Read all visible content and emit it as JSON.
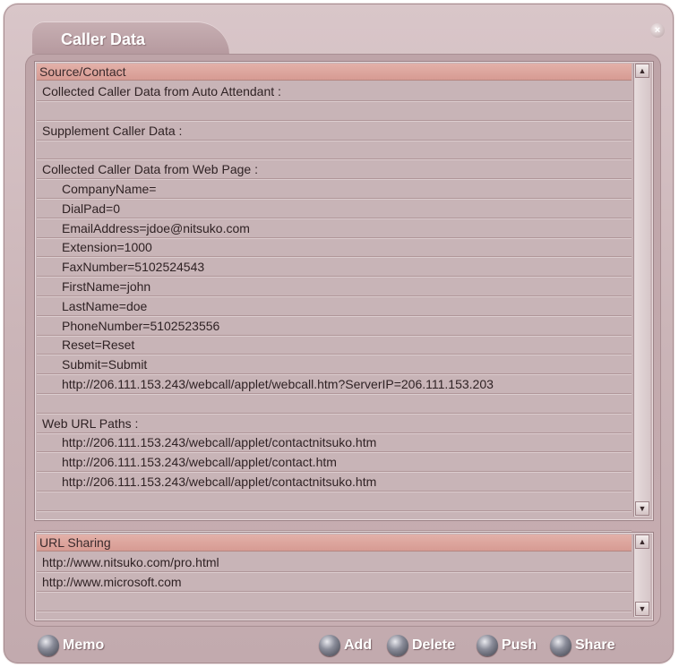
{
  "window": {
    "title": "Caller Data",
    "close_icon": "close-icon"
  },
  "source_list": {
    "header": "Source/Contact",
    "rows": [
      {
        "text": "Collected Caller Data from Auto Attendant :",
        "indent": false
      },
      {
        "text": "",
        "indent": false
      },
      {
        "text": "Supplement Caller Data :",
        "indent": false
      },
      {
        "text": "",
        "indent": false
      },
      {
        "text": "Collected Caller Data from Web Page :",
        "indent": false
      },
      {
        "text": "CompanyName=",
        "indent": true
      },
      {
        "text": "DialPad=0",
        "indent": true
      },
      {
        "text": "EmailAddress=jdoe@nitsuko.com",
        "indent": true
      },
      {
        "text": "Extension=1000",
        "indent": true
      },
      {
        "text": "FaxNumber=5102524543",
        "indent": true
      },
      {
        "text": "FirstName=john",
        "indent": true
      },
      {
        "text": "LastName=doe",
        "indent": true
      },
      {
        "text": "PhoneNumber=5102523556",
        "indent": true
      },
      {
        "text": "Reset=Reset",
        "indent": true
      },
      {
        "text": "Submit=Submit",
        "indent": true
      },
      {
        "text": "http://206.111.153.243/webcall/applet/webcall.htm?ServerIP=206.111.153.203",
        "indent": true
      },
      {
        "text": "",
        "indent": false
      },
      {
        "text": "Web URL Paths :",
        "indent": false
      },
      {
        "text": "http://206.111.153.243/webcall/applet/contactnitsuko.htm",
        "indent": true
      },
      {
        "text": "http://206.111.153.243/webcall/applet/contact.htm",
        "indent": true
      },
      {
        "text": "http://206.111.153.243/webcall/applet/contactnitsuko.htm",
        "indent": true
      },
      {
        "text": "",
        "indent": false
      },
      {
        "text": "",
        "indent": false
      }
    ]
  },
  "url_list": {
    "header": "URL Sharing",
    "rows": [
      {
        "text": "http://www.nitsuko.com/pro.html"
      },
      {
        "text": "http://www.microsoft.com"
      },
      {
        "text": ""
      }
    ]
  },
  "buttons": {
    "memo": "Memo",
    "add": "Add",
    "delete": "Delete",
    "push": "Push",
    "share": "Share"
  },
  "icons": {
    "scroll_up": "scroll-up-arrow-icon",
    "scroll_down": "scroll-down-arrow-icon",
    "button_orb": "orb-icon"
  }
}
